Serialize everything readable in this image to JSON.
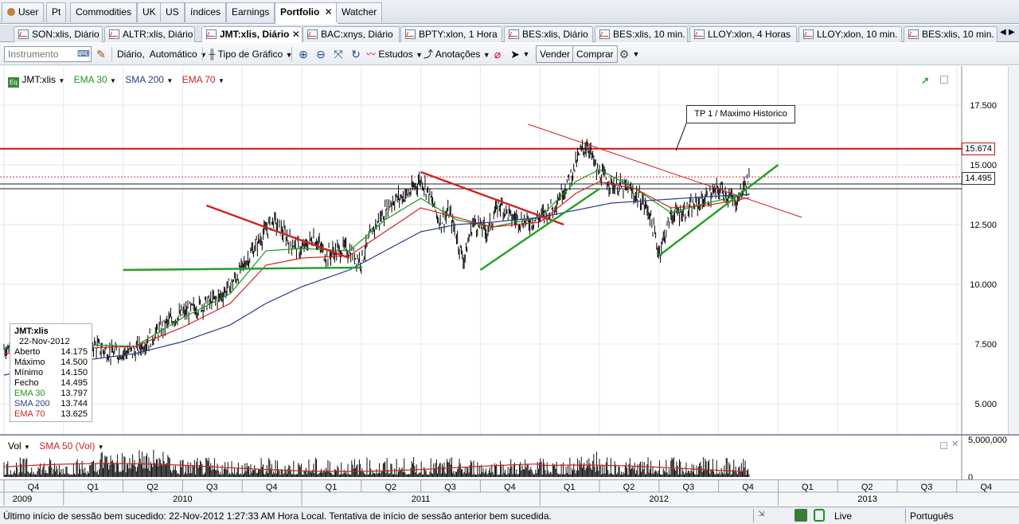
{
  "top_tabs": [
    {
      "label": "User",
      "icon": "user-icon"
    },
    {
      "label": "Pt"
    },
    {
      "label": "Commodities"
    },
    {
      "label": "UK"
    },
    {
      "label": "US"
    },
    {
      "label": "índices"
    },
    {
      "label": "Earnings"
    },
    {
      "label": "Portfolio",
      "active": true,
      "closable": true
    },
    {
      "label": "Watcher"
    }
  ],
  "chart_tabs": [
    {
      "label": "SON:xlis, Diário"
    },
    {
      "label": "ALTR:xlis, Diário"
    },
    {
      "label": "JMT:xlis, Diário",
      "active": true
    },
    {
      "label": "BAC:xnys, Diário"
    },
    {
      "label": "BPTY:xlon, 1 Hora"
    },
    {
      "label": "BES:xlis, Diário"
    },
    {
      "label": "BES:xlis, 10 min."
    },
    {
      "label": "LLOY:xlon, 4 Horas"
    },
    {
      "label": "LLOY:xlon, 10 min."
    },
    {
      "label": "BES:xlis, 10 min."
    }
  ],
  "toolbar": {
    "instrument_placeholder": "Instrumento",
    "period": "Diário,",
    "period_mode": "Automático",
    "chart_type": "Tipo de Gráfico",
    "studies": "Estudos",
    "annotations": "Anotações",
    "sell": "Vender",
    "buy": "Comprar"
  },
  "legend": {
    "symbol": "JMT:xlis",
    "ema30": "EMA 30",
    "sma200": "SMA 200",
    "ema70": "EMA 70",
    "vol": "Vol",
    "sma50vol": "SMA 50 (Vol)"
  },
  "colors": {
    "price": "#000000",
    "ema30": "#1a9a1a",
    "sma200": "#2a3d8f",
    "ema70": "#d42020",
    "trend_red": "#d42020",
    "trend_green": "#22a022",
    "level_red": "#cc1111"
  },
  "ohlc_box": {
    "title": "JMT:xlis",
    "date": "22-Nov-2012",
    "rows": [
      {
        "label": "Aberto",
        "value": "14.175"
      },
      {
        "label": "Máximo",
        "value": "14.500"
      },
      {
        "label": "Mínimo",
        "value": "14.150"
      },
      {
        "label": "Fecho",
        "value": "14.495"
      },
      {
        "label": "EMA 30",
        "value": "13.797",
        "color": "#1a9a1a"
      },
      {
        "label": "SMA 200",
        "value": "13.744",
        "color": "#2a3d8f"
      },
      {
        "label": "EMA 70",
        "value": "13.625",
        "color": "#d42020"
      }
    ]
  },
  "annotation": "TP 1 / Maximo Historico",
  "price_tags": {
    "level": "15.674",
    "last": "14.495"
  },
  "y_axis_labels": [
    "17.500",
    "15.000",
    "12.500",
    "10.000",
    "7.500",
    "5.000"
  ],
  "vol_axis_labels": [
    "5,000,000",
    "0"
  ],
  "time_axis": {
    "quarters": [
      "Q4",
      "Q1",
      "Q2",
      "Q3",
      "Q4",
      "Q1",
      "Q2",
      "Q3",
      "Q4",
      "Q1",
      "Q2",
      "Q3",
      "Q4",
      "Q1",
      "Q2",
      "Q3",
      "Q4"
    ],
    "years": [
      "2009",
      "2010",
      "2011",
      "2012",
      "2013"
    ]
  },
  "chart_data": {
    "type": "line",
    "ylim": [
      4.5,
      19
    ],
    "series": [
      {
        "name": "JMT:xlis",
        "points": [
          [
            2009.75,
            7.3
          ],
          [
            2009.9,
            7.8
          ],
          [
            2010.0,
            7.4
          ],
          [
            2010.1,
            7.6
          ],
          [
            2010.2,
            7.1
          ],
          [
            2010.3,
            7.2
          ],
          [
            2010.35,
            7.6
          ],
          [
            2010.45,
            8.5
          ],
          [
            2010.55,
            9.0
          ],
          [
            2010.65,
            9.4
          ],
          [
            2010.72,
            10.2
          ],
          [
            2010.8,
            11.5
          ],
          [
            2010.88,
            12.7
          ],
          [
            2010.95,
            11.8
          ],
          [
            2011.0,
            11.4
          ],
          [
            2011.05,
            12.0
          ],
          [
            2011.1,
            11.2
          ],
          [
            2011.18,
            11.5
          ],
          [
            2011.25,
            11.0
          ],
          [
            2011.3,
            12.3
          ],
          [
            2011.38,
            13.5
          ],
          [
            2011.45,
            13.8
          ],
          [
            2011.5,
            14.4
          ],
          [
            2011.53,
            13.9
          ],
          [
            2011.58,
            12.6
          ],
          [
            2011.62,
            13.0
          ],
          [
            2011.68,
            11.0
          ],
          [
            2011.72,
            12.6
          ],
          [
            2011.78,
            12.2
          ],
          [
            2011.83,
            13.4
          ],
          [
            2011.88,
            12.8
          ],
          [
            2011.95,
            12.6
          ],
          [
            2012.0,
            12.8
          ],
          [
            2012.05,
            13.2
          ],
          [
            2012.12,
            14.3
          ],
          [
            2012.17,
            15.5
          ],
          [
            2012.2,
            15.9
          ],
          [
            2012.24,
            14.7
          ],
          [
            2012.3,
            14.2
          ],
          [
            2012.36,
            14.0
          ],
          [
            2012.42,
            13.6
          ],
          [
            2012.46,
            13.0
          ],
          [
            2012.5,
            11.3
          ],
          [
            2012.55,
            12.9
          ],
          [
            2012.62,
            13.1
          ],
          [
            2012.7,
            13.6
          ],
          [
            2012.76,
            14.0
          ],
          [
            2012.82,
            13.4
          ],
          [
            2012.88,
            14.495
          ]
        ]
      },
      {
        "name": "EMA 30",
        "points": [
          [
            2009.75,
            7.3
          ],
          [
            2010.0,
            7.5
          ],
          [
            2010.3,
            7.4
          ],
          [
            2010.5,
            8.6
          ],
          [
            2010.7,
            9.6
          ],
          [
            2010.85,
            11.4
          ],
          [
            2011.0,
            11.5
          ],
          [
            2011.2,
            11.4
          ],
          [
            2011.35,
            12.7
          ],
          [
            2011.5,
            13.6
          ],
          [
            2011.65,
            12.7
          ],
          [
            2011.8,
            12.4
          ],
          [
            2012.0,
            12.8
          ],
          [
            2012.15,
            14.3
          ],
          [
            2012.25,
            14.8
          ],
          [
            2012.4,
            14.0
          ],
          [
            2012.55,
            13.0
          ],
          [
            2012.7,
            13.4
          ],
          [
            2012.88,
            13.797
          ]
        ]
      },
      {
        "name": "EMA 70",
        "points": [
          [
            2009.75,
            7.1
          ],
          [
            2010.0,
            7.3
          ],
          [
            2010.3,
            7.4
          ],
          [
            2010.5,
            8.2
          ],
          [
            2010.7,
            9.2
          ],
          [
            2010.85,
            10.8
          ],
          [
            2011.0,
            11.1
          ],
          [
            2011.2,
            11.2
          ],
          [
            2011.35,
            12.2
          ],
          [
            2011.5,
            13.2
          ],
          [
            2011.65,
            12.8
          ],
          [
            2011.8,
            12.4
          ],
          [
            2012.0,
            12.6
          ],
          [
            2012.15,
            13.8
          ],
          [
            2012.25,
            14.3
          ],
          [
            2012.4,
            14.0
          ],
          [
            2012.55,
            13.2
          ],
          [
            2012.7,
            13.3
          ],
          [
            2012.88,
            13.625
          ]
        ]
      },
      {
        "name": "SMA 200",
        "points": [
          [
            2009.75,
            6.2
          ],
          [
            2010.0,
            6.7
          ],
          [
            2010.3,
            7.1
          ],
          [
            2010.5,
            7.6
          ],
          [
            2010.7,
            8.3
          ],
          [
            2010.85,
            9.2
          ],
          [
            2011.0,
            9.9
          ],
          [
            2011.2,
            10.6
          ],
          [
            2011.35,
            11.4
          ],
          [
            2011.5,
            12.2
          ],
          [
            2011.65,
            12.5
          ],
          [
            2011.8,
            12.6
          ],
          [
            2012.0,
            12.8
          ],
          [
            2012.15,
            13.1
          ],
          [
            2012.3,
            13.4
          ],
          [
            2012.45,
            13.5
          ],
          [
            2012.6,
            13.6
          ],
          [
            2012.75,
            13.7
          ],
          [
            2012.88,
            13.744
          ]
        ]
      }
    ],
    "trendlines": [
      {
        "color": "red",
        "from": [
          2010.6,
          13.3
        ],
        "to": [
          2011.2,
          11.1
        ]
      },
      {
        "color": "green",
        "from": [
          2010.25,
          10.6
        ],
        "to": [
          2011.25,
          10.7
        ]
      },
      {
        "color": "red",
        "from": [
          2011.5,
          14.7
        ],
        "to": [
          2012.1,
          12.5
        ]
      },
      {
        "color": "green",
        "from": [
          2011.75,
          10.6
        ],
        "to": [
          2012.25,
          14.0
        ]
      },
      {
        "color": "red",
        "from": [
          2011.95,
          16.7
        ],
        "to": [
          2013.1,
          12.8
        ]
      },
      {
        "color": "green",
        "from": [
          2012.5,
          11.2
        ],
        "to": [
          2013.0,
          15.0
        ]
      }
    ],
    "levels": [
      15.674,
      14.495,
      14.2,
      14.0
    ],
    "volume_max": 5000000
  }
}
